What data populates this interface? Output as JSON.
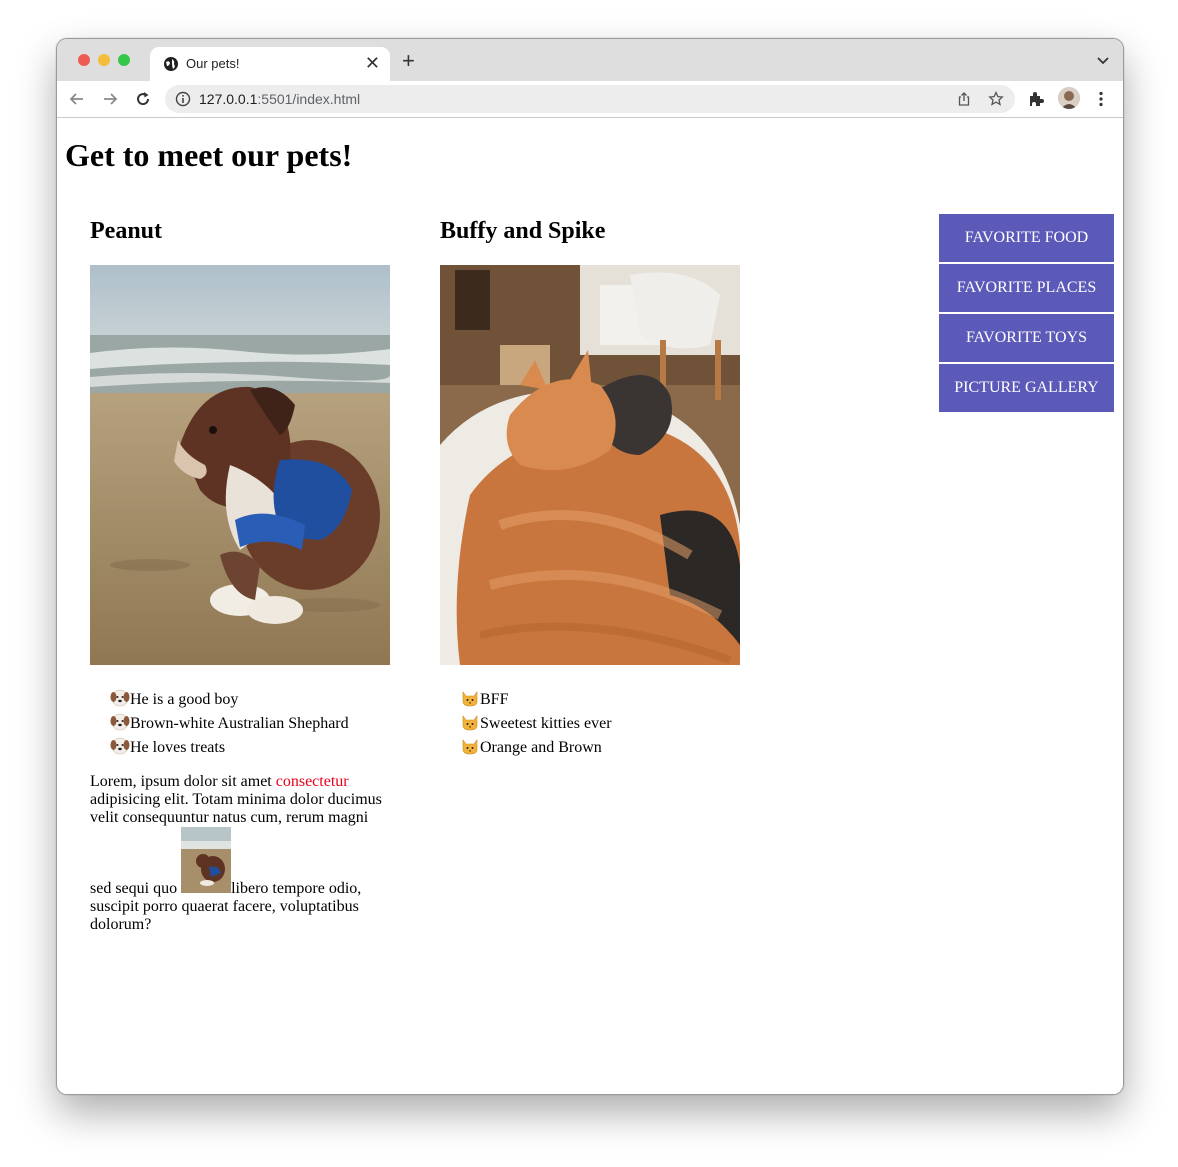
{
  "browser": {
    "tab_title": "Our pets!",
    "new_tab_symbol": "+",
    "close_symbol": "✕",
    "url_host": "127.0.0.1",
    "url_path": ":5501/index.html"
  },
  "page": {
    "heading": "Get to meet our pets!",
    "pets": [
      {
        "name": "Peanut",
        "facts": [
          "He is a good boy",
          "Brown-white Australian Shephard",
          "He loves treats"
        ],
        "emoji": "🐶"
      },
      {
        "name": "Buffy and Spike",
        "facts": [
          "BFF",
          "Sweetest kitties ever",
          "Orange and Brown"
        ],
        "emoji": "🐱"
      }
    ],
    "lorem": {
      "before": "Lorem, ipsum dolor sit amet ",
      "link": "consectetur",
      "middle": " adipisicing elit. Totam minima dolor ducimus velit consequuntur natus cum, rerum magni sed sequi quo ",
      "after": "libero tempore odio, suscipit porro quaerat facere, voluptatibus dolorum?"
    },
    "nav": [
      "FAVORITE FOOD",
      "FAVORITE PLACES",
      "FAVORITE TOYS",
      "PICTURE GALLERY"
    ],
    "colors": {
      "nav_bg": "#5c5ab8",
      "highlight": "#e8001c"
    },
    "icons": [
      "globe-icon",
      "back-icon",
      "forward-icon",
      "reload-icon",
      "info-icon",
      "share-icon",
      "star-icon",
      "extensions-icon",
      "kebab-menu-icon",
      "chevron-down-icon"
    ]
  }
}
